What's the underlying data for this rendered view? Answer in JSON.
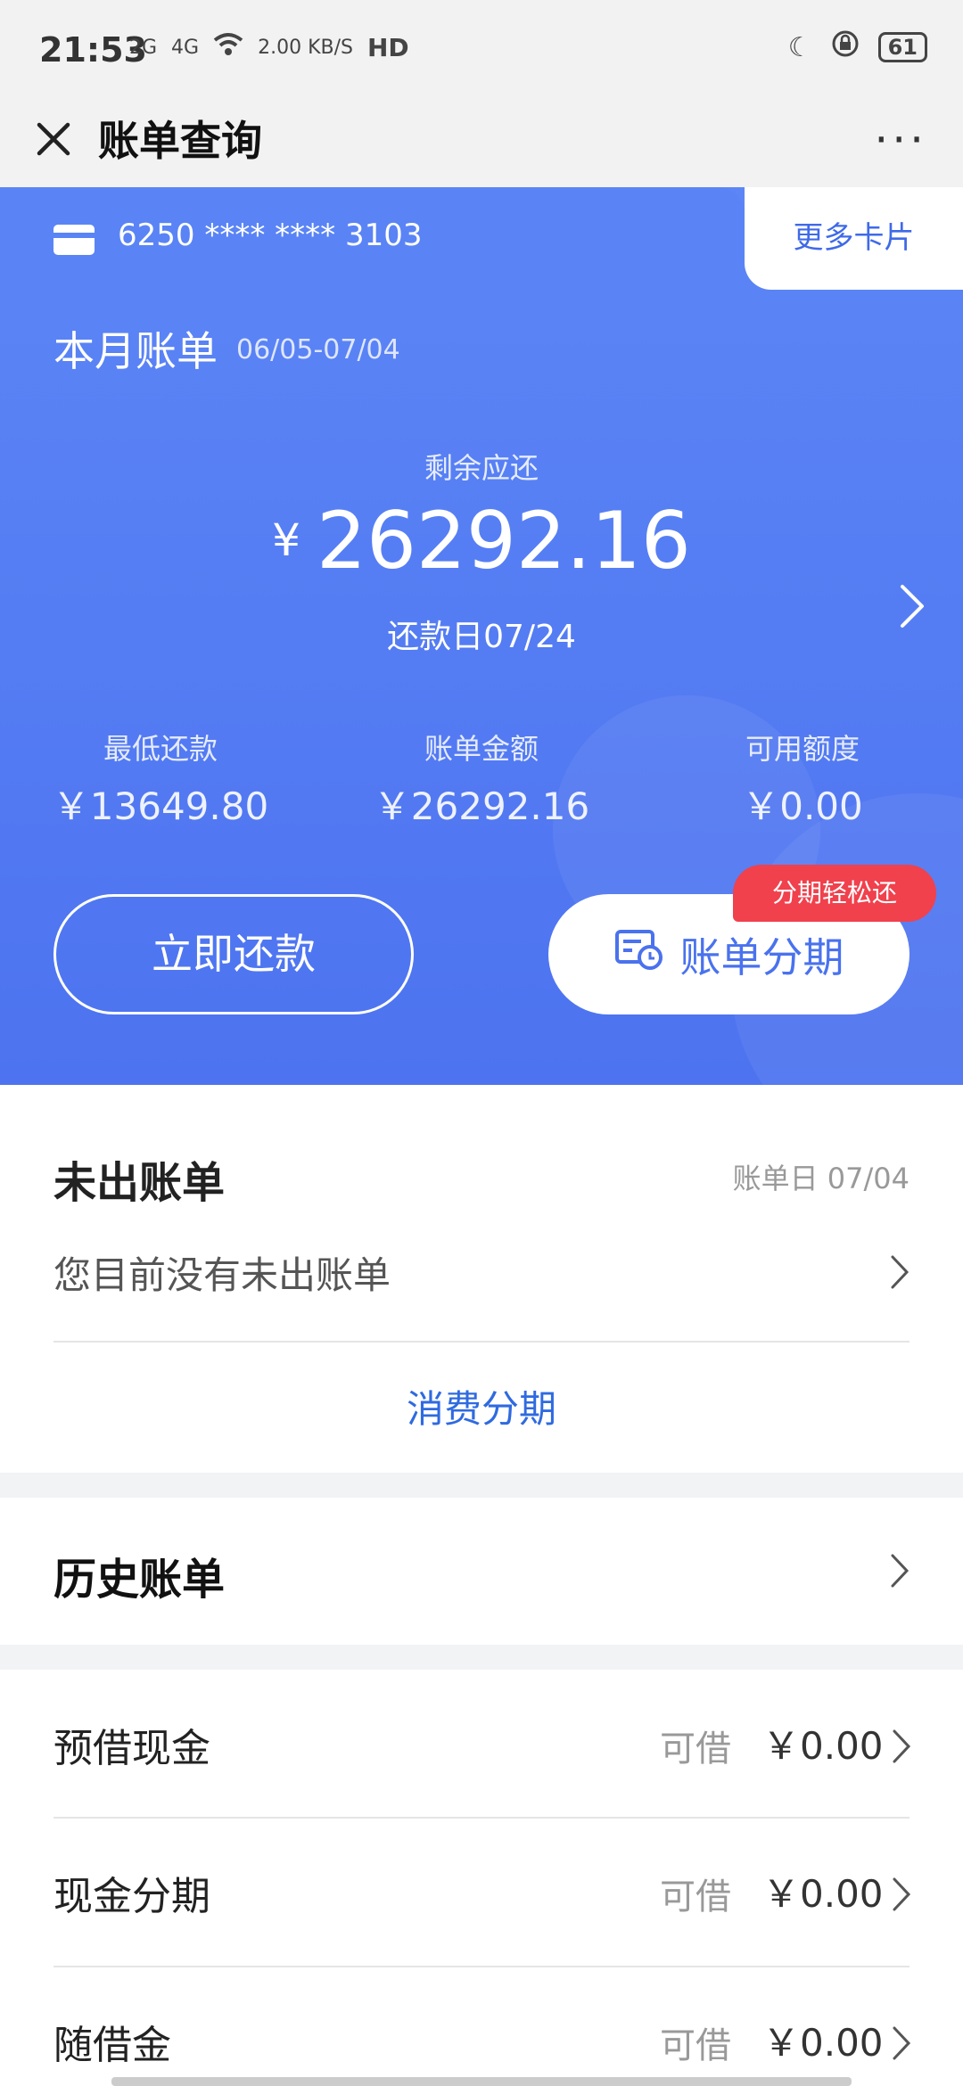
{
  "status_bar": {
    "time": "21:53",
    "signal_1": "2G",
    "signal_2": "4G",
    "speed": "2.00 KB/S",
    "hd": "HD",
    "battery": "61"
  },
  "nav": {
    "title": "账单查询"
  },
  "card": {
    "number": "6250 **** **** 3103",
    "more_cards": "更多卡片",
    "month_title": "本月账单",
    "month_range": "06/05-07/04",
    "remaining_label": "剩余应还",
    "currency": "¥",
    "remaining_amount": "26292.16",
    "due_date": "还款日07/24",
    "stats": [
      {
        "label": "最低还款",
        "value": "￥13649.80"
      },
      {
        "label": "账单金额",
        "value": "￥26292.16"
      },
      {
        "label": "可用额度",
        "value": "￥0.00"
      }
    ],
    "repay_button": "立即还款",
    "installment_button": "账单分期",
    "promo_badge": "分期轻松还"
  },
  "unbilled": {
    "title": "未出账单",
    "bill_date": "账单日 07/04",
    "description": "您目前没有未出账单",
    "consume_installment": "消费分期"
  },
  "history": {
    "title": "历史账单"
  },
  "loans": [
    {
      "label": "预借现金",
      "available": "可借",
      "amount": "￥0.00"
    },
    {
      "label": "现金分期",
      "available": "可借",
      "amount": "￥0.00"
    },
    {
      "label": "随借金",
      "available": "可借",
      "amount": "￥0.00"
    }
  ],
  "colors": {
    "card_blue": "#4d73f0",
    "accent_blue": "#2f6ae0",
    "badge_red": "#f0414d"
  }
}
